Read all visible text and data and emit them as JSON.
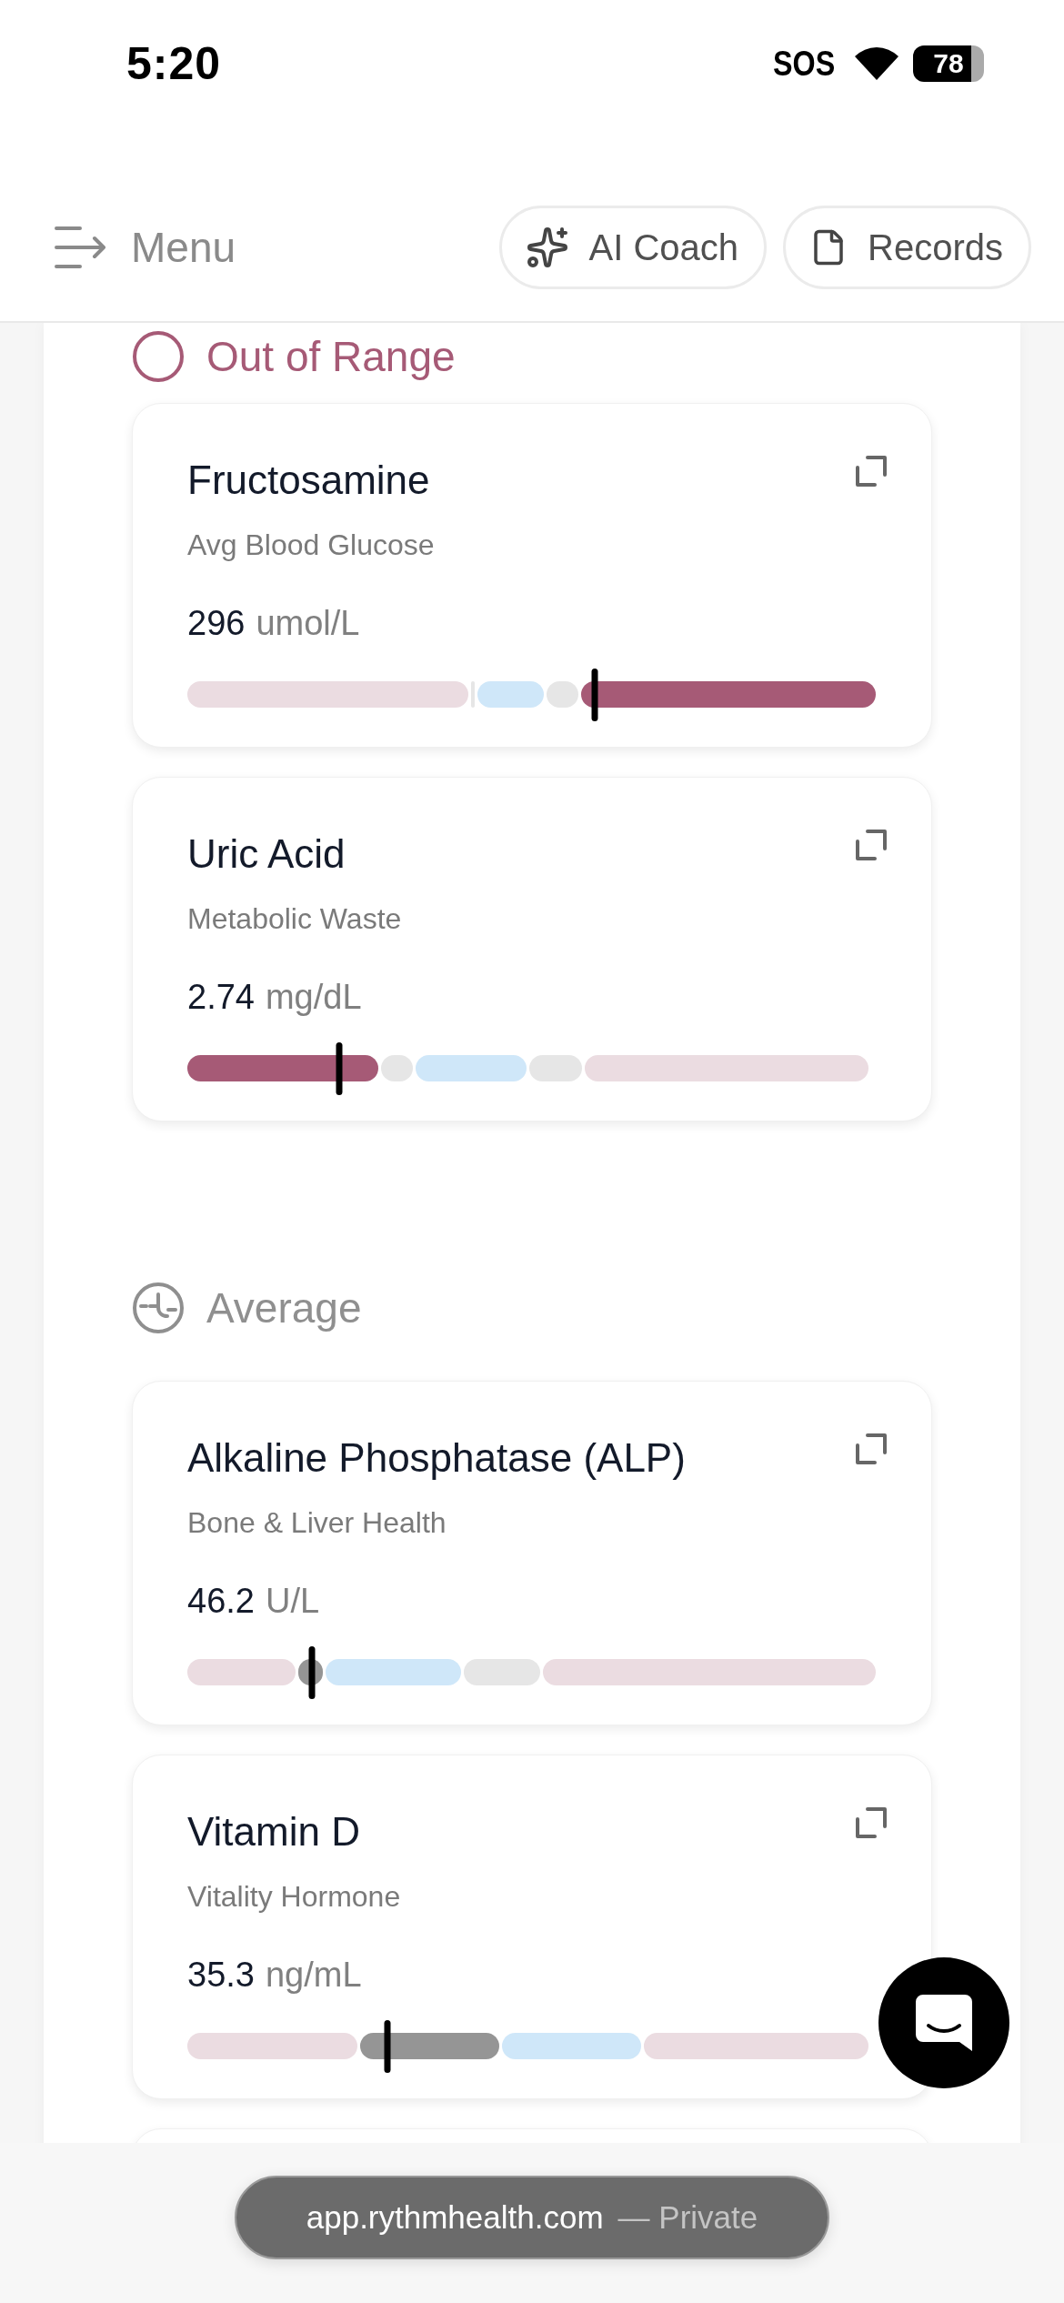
{
  "status_bar": {
    "time": "5:20",
    "sos": "SOS",
    "battery": "78"
  },
  "header": {
    "menu": "Menu",
    "buttons": [
      {
        "kind": "coach",
        "label": "AI Coach"
      },
      {
        "kind": "records",
        "label": "Records"
      }
    ]
  },
  "sections": [
    {
      "kind": "out_of_range",
      "title": "Out of Range",
      "cards": [
        {
          "name": "Fructosamine",
          "subtitle": "Avg Blood Glucose",
          "value": "296",
          "unit": "umol/L",
          "marker": {
            "level": 0.59
          },
          "segments": [
            {
              "kind": "out",
              "active": false
            },
            {
              "kind": "normal",
              "active": false
            },
            {
              "kind": "optimal",
              "active": false
            },
            {
              "kind": "normal",
              "active": false
            },
            {
              "kind": "out",
              "active": true
            }
          ]
        },
        {
          "name": "Uric Acid",
          "subtitle": "Metabolic Waste",
          "value": "2.74",
          "unit": "mg/dL",
          "marker": {
            "level": 0.22
          },
          "segments": [
            {
              "kind": "out",
              "active": true
            },
            {
              "kind": "normal",
              "active": false
            },
            {
              "kind": "optimal",
              "active": false
            },
            {
              "kind": "normal",
              "active": false
            },
            {
              "kind": "out",
              "active": false
            }
          ]
        }
      ]
    },
    {
      "kind": "average",
      "title": "Average",
      "cards": [
        {
          "name": "Alkaline Phosphatase (ALP)",
          "subtitle": "Bone & Liver Health",
          "value": "46.2",
          "unit": "U/L",
          "marker": {
            "level": 0.18
          },
          "segments": [
            {
              "kind": "out",
              "active": false
            },
            {
              "kind": "normal",
              "active": true
            },
            {
              "kind": "optimal",
              "active": false
            },
            {
              "kind": "normal",
              "active": false
            },
            {
              "kind": "out",
              "active": false
            }
          ]
        },
        {
          "name": "Vitamin D",
          "subtitle": "Vitality Hormone",
          "value": "35.3",
          "unit": "ng/mL",
          "marker": {
            "level": 0.29
          },
          "segments": [
            {
              "kind": "out",
              "active": false
            },
            {
              "kind": "normal",
              "active": true
            },
            {
              "kind": "optimal",
              "active": false
            },
            {
              "kind": "out",
              "active": false
            }
          ]
        }
      ]
    }
  ],
  "browser_bar": {
    "url": "app.rythmhealth.com",
    "suffix": "— Private"
  }
}
